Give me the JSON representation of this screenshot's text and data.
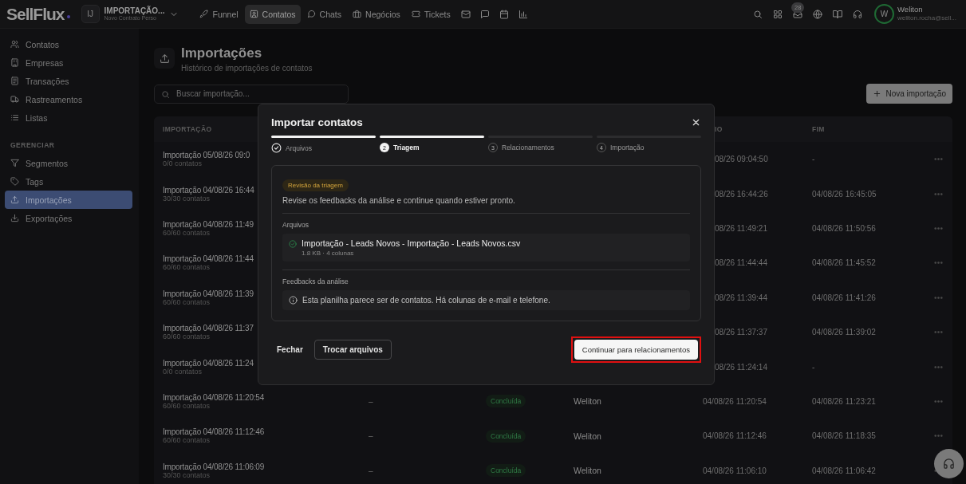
{
  "brand": {
    "logo": "SellFlux"
  },
  "workspace": {
    "initials": "IJ",
    "name": "IMPORTAÇÃO...",
    "plan": "Novo Contrato Perso"
  },
  "nav": [
    {
      "label": "Funnel",
      "selected": false
    },
    {
      "label": "Contatos",
      "selected": true
    },
    {
      "label": "Chats",
      "selected": false
    },
    {
      "label": "Negócios",
      "selected": false
    },
    {
      "label": "Tickets",
      "selected": false
    }
  ],
  "notifications": {
    "badge": "28"
  },
  "user": {
    "initials": "W",
    "name": "Weliton",
    "email": "weliton.rocha@sell..."
  },
  "sidebar": {
    "items": [
      {
        "label": "Contatos",
        "selected": false
      },
      {
        "label": "Empresas",
        "selected": false
      },
      {
        "label": "Transações",
        "selected": false
      },
      {
        "label": "Rastreamentos",
        "selected": false
      },
      {
        "label": "Listas",
        "selected": false
      }
    ],
    "section": {
      "title": "GERENCIAR",
      "items": [
        {
          "label": "Segmentos",
          "selected": false
        },
        {
          "label": "Tags",
          "selected": false
        },
        {
          "label": "Importações",
          "selected": true
        },
        {
          "label": "Exportações",
          "selected": false
        }
      ]
    }
  },
  "page": {
    "title": "Importações",
    "subtitle": "Histórico de importações de contatos",
    "search": {
      "placeholder": "Buscar importação..."
    },
    "new_button": "Nova importação"
  },
  "table": {
    "columns": {
      "importacao": "IMPORTAÇÃO",
      "column_6": "IO",
      "fim": "FIM"
    },
    "rows": [
      {
        "title": "Importação 05/08/26 09:0",
        "count": "0/0 contatos",
        "start": "08/26 09:04:50",
        "end": "-"
      },
      {
        "title": "Importação 04/08/26 16:44",
        "count": "30/30 contatos",
        "start": "08/26 16:44:26",
        "end": "04/08/26 16:45:05"
      },
      {
        "title": "Importação 04/08/26 11:49",
        "count": "60/60 contatos",
        "start": "08/26 11:49:21",
        "end": "04/08/26 11:50:56"
      },
      {
        "title": "Importação 04/08/26 11:44",
        "count": "60/60 contatos",
        "start": "08/26 11:44:44",
        "end": "04/08/26 11:45:52"
      },
      {
        "title": "Importação 04/08/26 11:39",
        "count": "60/60 contatos",
        "start": "08/26 11:39:44",
        "end": "04/08/26 11:41:26"
      },
      {
        "title": "Importação 04/08/26 11:37",
        "count": "60/60 contatos",
        "start": "08/26 11:37:37",
        "end": "04/08/26 11:39:02"
      },
      {
        "title": "Importação 04/08/26 11:24",
        "count": "0/0 contatos",
        "start": "08/26 11:24:14",
        "end": "-"
      },
      {
        "title": "Importação 04/08/26 11:20:54",
        "count": "60/60 contatos",
        "source": "–",
        "status": "Concluída",
        "user": "Weliton",
        "start": "04/08/26 11:20:54",
        "end": "04/08/26 11:23:21"
      },
      {
        "title": "Importação 04/08/26 11:12:46",
        "count": "60/60 contatos",
        "source": "–",
        "status": "Concluída",
        "user": "Weliton",
        "start": "04/08/26 11:12:46",
        "end": "04/08/26 11:18:35"
      },
      {
        "title": "Importação 04/08/26 11:06:09",
        "count": "30/30 contatos",
        "source": "–",
        "status": "Concluída",
        "user": "Weliton",
        "start": "04/08/26 11:06:10",
        "end": "04/08/26 11:06:42"
      }
    ]
  },
  "modal": {
    "title": "Importar contatos",
    "steps": [
      {
        "label": "Arquivos",
        "reached": true,
        "completed": true,
        "selected": false
      },
      {
        "label": "Triagem",
        "number": "2",
        "reached": true,
        "completed": false,
        "selected": true
      },
      {
        "label": "Relacionamentos",
        "number": "3",
        "reached": false,
        "completed": false,
        "selected": false
      },
      {
        "label": "Importação",
        "number": "4",
        "reached": false,
        "completed": false,
        "selected": false
      }
    ],
    "badge": "Revisão da triagem",
    "description": "Revise os feedbacks da análise e continue quando estiver pronto.",
    "files_label": "Arquivos",
    "file": {
      "name": "Importação - Leads Novos - Importação - Leads Novos.csv",
      "meta": "1.8 KB · 4 colunas"
    },
    "feedback_label": "Feedbacks da análise",
    "feedback": "Esta planilha parece ser de contatos. Há colunas de e-mail e telefone.",
    "buttons": {
      "close": "Fechar",
      "change": "Trocar arquivos",
      "continue": "Continuar para relacionamentos",
      "highlighted": true
    }
  }
}
